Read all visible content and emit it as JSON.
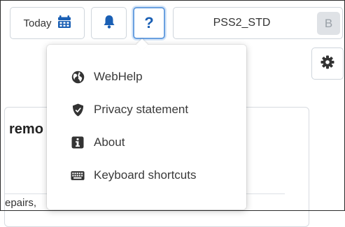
{
  "toolbar": {
    "today_label": "Today",
    "help_label": "?",
    "user_name": "PSS2_STD",
    "user_initial": "B"
  },
  "help_menu": {
    "items": [
      {
        "label": "WebHelp",
        "icon": "globe-icon"
      },
      {
        "label": "Privacy statement",
        "icon": "shield-icon"
      },
      {
        "label": "About",
        "icon": "info-icon"
      },
      {
        "label": "Keyboard shortcuts",
        "icon": "keyboard-icon"
      }
    ]
  },
  "background_panel": {
    "title_fragment": "remo",
    "text_fragment": "epairs,"
  },
  "colors": {
    "accent": "#1a5fb4",
    "icon_dark": "#333333"
  }
}
